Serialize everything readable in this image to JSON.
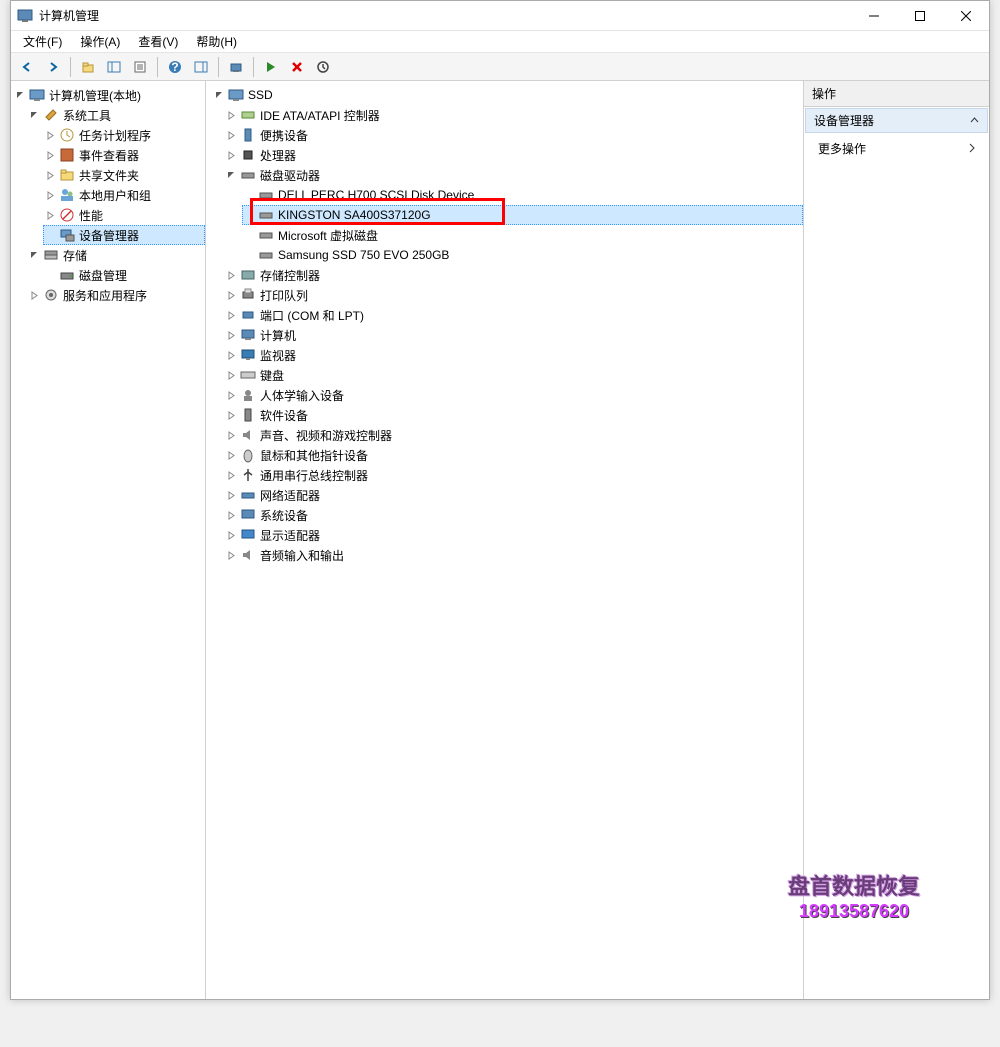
{
  "window": {
    "title": "计算机管理"
  },
  "menubar": {
    "file": "文件(F)",
    "action": "操作(A)",
    "view": "查看(V)",
    "help": "帮助(H)"
  },
  "leftTree": {
    "root": "计算机管理(本地)",
    "systemTools": "系统工具",
    "taskScheduler": "任务计划程序",
    "eventViewer": "事件查看器",
    "sharedFolders": "共享文件夹",
    "localUsers": "本地用户和组",
    "performance": "性能",
    "deviceManager": "设备管理器",
    "storage": "存储",
    "diskMgmt": "磁盘管理",
    "services": "服务和应用程序"
  },
  "centerTree": {
    "root": "SSD",
    "ideAta": "IDE ATA/ATAPI 控制器",
    "portable": "便携设备",
    "cpu": "处理器",
    "diskDrives": "磁盘驱动器",
    "disk1": "DELL PERC H700 SCSI Disk Device",
    "disk2": "KINGSTON SA400S37120G",
    "disk3": "Microsoft 虚拟磁盘",
    "disk4": "Samsung SSD 750 EVO 250GB",
    "storageCtrl": "存储控制器",
    "printQueue": "打印队列",
    "ports": "端口 (COM 和 LPT)",
    "computer": "计算机",
    "monitor": "监视器",
    "keyboard": "键盘",
    "hid": "人体学输入设备",
    "software": "软件设备",
    "audioVideo": "声音、视频和游戏控制器",
    "mouse": "鼠标和其他指针设备",
    "usb": "通用串行总线控制器",
    "network": "网络适配器",
    "systemDev": "系统设备",
    "display": "显示适配器",
    "audioIO": "音频输入和输出"
  },
  "rightPane": {
    "header": "操作",
    "section": "设备管理器",
    "moreActions": "更多操作"
  },
  "watermark": {
    "line1": "盘首数据恢复",
    "line2": "18913587620"
  }
}
